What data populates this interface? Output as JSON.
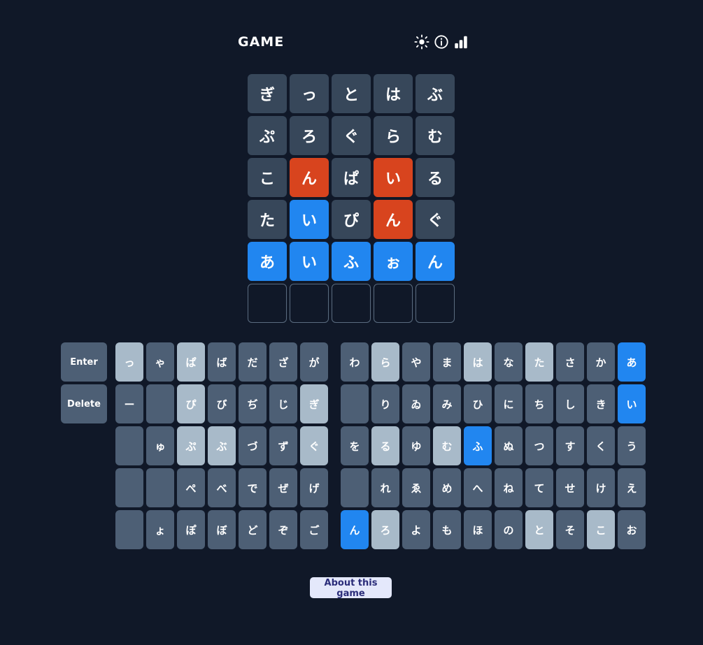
{
  "header": {
    "title": "GAME",
    "icons": [
      {
        "name": "brightness-icon",
        "label": "brightness"
      },
      {
        "name": "info-icon",
        "label": "info"
      },
      {
        "name": "stats-icon",
        "label": "statistics"
      }
    ]
  },
  "board": {
    "rows": 6,
    "cols": 5,
    "guesses": [
      {
        "letters": [
          "ぎ",
          "っ",
          "と",
          "は",
          "ぶ"
        ],
        "states": [
          "absent",
          "absent",
          "absent",
          "absent",
          "absent"
        ]
      },
      {
        "letters": [
          "ぷ",
          "ろ",
          "ぐ",
          "ら",
          "む"
        ],
        "states": [
          "absent",
          "absent",
          "absent",
          "absent",
          "absent"
        ]
      },
      {
        "letters": [
          "こ",
          "ん",
          "ぱ",
          "い",
          "る"
        ],
        "states": [
          "absent",
          "present",
          "absent",
          "present",
          "absent"
        ]
      },
      {
        "letters": [
          "た",
          "い",
          "ぴ",
          "ん",
          "ぐ"
        ],
        "states": [
          "absent",
          "correct",
          "absent",
          "present",
          "absent"
        ]
      },
      {
        "letters": [
          "あ",
          "い",
          "ふ",
          "ぉ",
          "ん"
        ],
        "states": [
          "correct",
          "correct",
          "correct",
          "correct",
          "correct"
        ]
      },
      {
        "letters": [
          "",
          "",
          "",
          "",
          ""
        ],
        "states": [
          "empty",
          "empty",
          "empty",
          "empty",
          "empty"
        ]
      }
    ]
  },
  "keyboard": {
    "enter_label": "Enter",
    "delete_label": "Delete",
    "rows": [
      [
        {
          "label": "Enter",
          "state": "unused",
          "wide": true
        },
        {
          "label": "っ",
          "state": "absent"
        },
        {
          "label": "ゃ",
          "state": "unused"
        },
        {
          "label": "ぱ",
          "state": "absent"
        },
        {
          "label": "ば",
          "state": "unused"
        },
        {
          "label": "だ",
          "state": "unused"
        },
        {
          "label": "ざ",
          "state": "unused"
        },
        {
          "label": "が",
          "state": "unused"
        },
        {
          "label": "わ",
          "state": "unused"
        },
        {
          "label": "ら",
          "state": "absent"
        },
        {
          "label": "や",
          "state": "unused"
        },
        {
          "label": "ま",
          "state": "unused"
        },
        {
          "label": "は",
          "state": "absent"
        },
        {
          "label": "な",
          "state": "unused"
        },
        {
          "label": "た",
          "state": "absent"
        },
        {
          "label": "さ",
          "state": "unused"
        },
        {
          "label": "か",
          "state": "unused"
        },
        {
          "label": "あ",
          "state": "correct"
        }
      ],
      [
        {
          "label": "Delete",
          "state": "unused",
          "wide": true
        },
        {
          "label": "ー",
          "state": "unused"
        },
        {
          "label": "",
          "state": "blank"
        },
        {
          "label": "ぴ",
          "state": "absent"
        },
        {
          "label": "び",
          "state": "unused"
        },
        {
          "label": "ぢ",
          "state": "unused"
        },
        {
          "label": "じ",
          "state": "unused"
        },
        {
          "label": "ぎ",
          "state": "absent"
        },
        {
          "label": "",
          "state": "blank"
        },
        {
          "label": "り",
          "state": "unused"
        },
        {
          "label": "ゐ",
          "state": "unused"
        },
        {
          "label": "み",
          "state": "unused"
        },
        {
          "label": "ひ",
          "state": "unused"
        },
        {
          "label": "に",
          "state": "unused"
        },
        {
          "label": "ち",
          "state": "unused"
        },
        {
          "label": "し",
          "state": "unused"
        },
        {
          "label": "き",
          "state": "unused"
        },
        {
          "label": "い",
          "state": "correct"
        }
      ],
      [
        {
          "label": "",
          "state": "hidden",
          "wide": true
        },
        {
          "label": "",
          "state": "blank"
        },
        {
          "label": "ゅ",
          "state": "unused"
        },
        {
          "label": "ぷ",
          "state": "absent"
        },
        {
          "label": "ぶ",
          "state": "absent"
        },
        {
          "label": "づ",
          "state": "unused"
        },
        {
          "label": "ず",
          "state": "unused"
        },
        {
          "label": "ぐ",
          "state": "absent"
        },
        {
          "label": "を",
          "state": "unused"
        },
        {
          "label": "る",
          "state": "absent"
        },
        {
          "label": "ゆ",
          "state": "unused"
        },
        {
          "label": "む",
          "state": "absent"
        },
        {
          "label": "ふ",
          "state": "correct"
        },
        {
          "label": "ぬ",
          "state": "unused"
        },
        {
          "label": "つ",
          "state": "unused"
        },
        {
          "label": "す",
          "state": "unused"
        },
        {
          "label": "く",
          "state": "unused"
        },
        {
          "label": "う",
          "state": "unused"
        }
      ],
      [
        {
          "label": "",
          "state": "hidden",
          "wide": true
        },
        {
          "label": "",
          "state": "blank"
        },
        {
          "label": "",
          "state": "blank"
        },
        {
          "label": "ぺ",
          "state": "unused"
        },
        {
          "label": "べ",
          "state": "unused"
        },
        {
          "label": "で",
          "state": "unused"
        },
        {
          "label": "ぜ",
          "state": "unused"
        },
        {
          "label": "げ",
          "state": "unused"
        },
        {
          "label": "",
          "state": "blank"
        },
        {
          "label": "れ",
          "state": "unused"
        },
        {
          "label": "ゑ",
          "state": "unused"
        },
        {
          "label": "め",
          "state": "unused"
        },
        {
          "label": "へ",
          "state": "unused"
        },
        {
          "label": "ね",
          "state": "unused"
        },
        {
          "label": "て",
          "state": "unused"
        },
        {
          "label": "せ",
          "state": "unused"
        },
        {
          "label": "け",
          "state": "unused"
        },
        {
          "label": "え",
          "state": "unused"
        }
      ],
      [
        {
          "label": "",
          "state": "hidden",
          "wide": true
        },
        {
          "label": "",
          "state": "blank"
        },
        {
          "label": "ょ",
          "state": "unused"
        },
        {
          "label": "ぽ",
          "state": "unused"
        },
        {
          "label": "ぼ",
          "state": "unused"
        },
        {
          "label": "ど",
          "state": "unused"
        },
        {
          "label": "ぞ",
          "state": "unused"
        },
        {
          "label": "ご",
          "state": "unused"
        },
        {
          "label": "ん",
          "state": "correct"
        },
        {
          "label": "ろ",
          "state": "absent"
        },
        {
          "label": "よ",
          "state": "unused"
        },
        {
          "label": "も",
          "state": "unused"
        },
        {
          "label": "ほ",
          "state": "unused"
        },
        {
          "label": "の",
          "state": "unused"
        },
        {
          "label": "と",
          "state": "absent"
        },
        {
          "label": "そ",
          "state": "unused"
        },
        {
          "label": "こ",
          "state": "absent"
        },
        {
          "label": "お",
          "state": "unused"
        }
      ]
    ]
  },
  "footer": {
    "about_label": "About this game"
  },
  "colors": {
    "background": "#101828",
    "tile_absent": "#37475a",
    "tile_present": "#d8441e",
    "tile_correct": "#2186f0",
    "key_unused": "#4d5f75",
    "key_absent": "#a8bac9",
    "about_bg": "#e4e8fb",
    "about_text": "#2b2d7a"
  }
}
